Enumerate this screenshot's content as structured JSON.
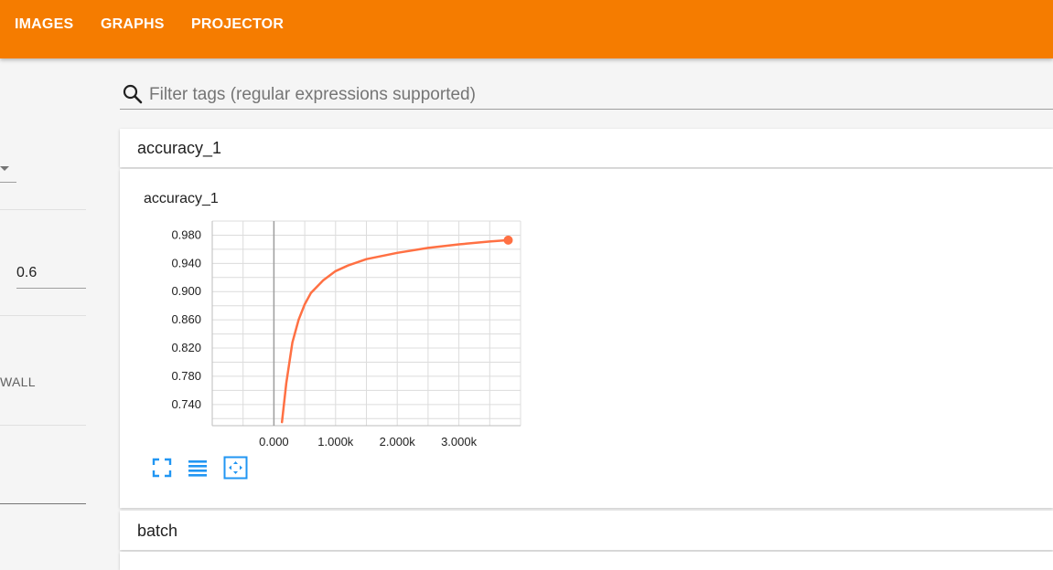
{
  "nav": {
    "tabs": [
      {
        "label": "IMAGES"
      },
      {
        "label": "GRAPHS"
      },
      {
        "label": "PROJECTOR"
      }
    ],
    "color": "#f57c00"
  },
  "sidebar": {
    "smoothing_value": "0.6",
    "horizontal_axis_fragment": "WALL"
  },
  "search": {
    "placeholder": "Filter tags (regular expressions supported)"
  },
  "cards": [
    {
      "header": "accuracy_1"
    },
    {
      "header": "batch"
    }
  ],
  "chart_data": {
    "type": "line",
    "title": "accuracy_1",
    "xlabel": "",
    "ylabel": "",
    "x_ticks": [
      "0.000",
      "1.000k",
      "2.000k",
      "3.000k"
    ],
    "y_ticks": [
      "0.980",
      "0.940",
      "0.900",
      "0.860",
      "0.820",
      "0.780",
      "0.740"
    ],
    "xlim": [
      -1000,
      4000
    ],
    "ylim": [
      0.71,
      1.0
    ],
    "grid": true,
    "series": [
      {
        "color": "#ff7043",
        "x": [
          130,
          200,
          300,
          400,
          500,
          600,
          800,
          1000,
          1200,
          1500,
          2000,
          2500,
          3000,
          3500,
          3800
        ],
        "y": [
          0.715,
          0.77,
          0.828,
          0.86,
          0.882,
          0.898,
          0.916,
          0.929,
          0.937,
          0.946,
          0.955,
          0.962,
          0.967,
          0.971,
          0.973
        ]
      }
    ]
  },
  "chart_buttons": [
    {
      "icon": "fullscreen-icon"
    },
    {
      "icon": "toggle-log-scale-icon"
    },
    {
      "icon": "fit-domain-icon"
    }
  ]
}
